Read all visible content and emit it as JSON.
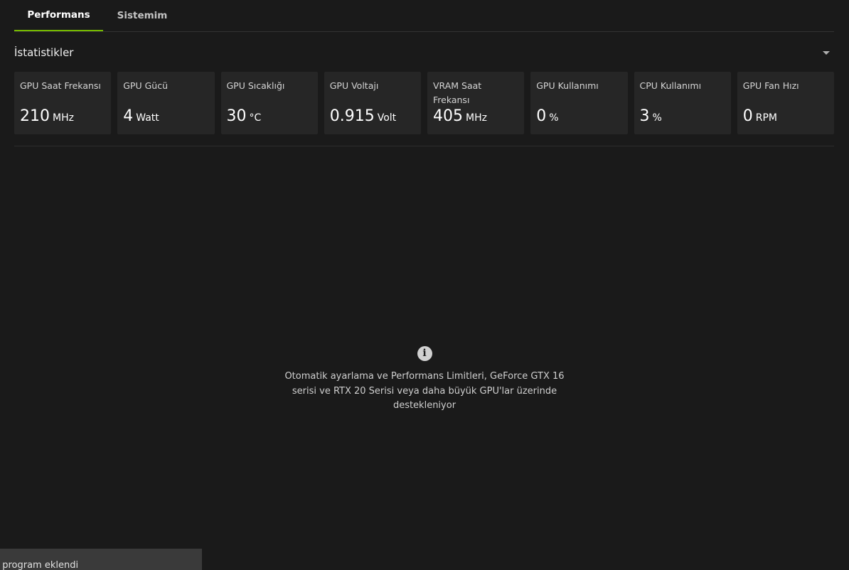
{
  "tabs": [
    {
      "label": "Performans",
      "active": true
    },
    {
      "label": "Sistemim",
      "active": false
    }
  ],
  "section": {
    "title": "İstatistikler",
    "collapse_icon": "caret-down-icon"
  },
  "stats": [
    {
      "label": "GPU Saat Frekansı",
      "value": "210",
      "unit": "MHz"
    },
    {
      "label": "GPU Gücü",
      "value": "4",
      "unit": "Watt"
    },
    {
      "label": "GPU Sıcaklığı",
      "value": "30",
      "unit": "°C"
    },
    {
      "label": "GPU Voltajı",
      "value": "0.915",
      "unit": "Volt"
    },
    {
      "label": "VRAM Saat Frekansı",
      "value": "405",
      "unit": "MHz"
    },
    {
      "label": "GPU Kullanımı",
      "value": "0",
      "unit": "%"
    },
    {
      "label": "CPU Kullanımı",
      "value": "3",
      "unit": "%"
    },
    {
      "label": "GPU Fan Hızı",
      "value": "0",
      "unit": "RPM"
    }
  ],
  "info": {
    "icon": "info-icon",
    "glyph": "i",
    "message": "Otomatik ayarlama ve Performans Limitleri, GeForce GTX 16 serisi ve RTX 20 Serisi veya daha büyük GPU'lar üzerinde destekleniyor"
  },
  "toast": {
    "text": "t program eklendi"
  },
  "colors": {
    "background": "#1a1a1a",
    "card": "#262626",
    "accent": "#76b900"
  }
}
